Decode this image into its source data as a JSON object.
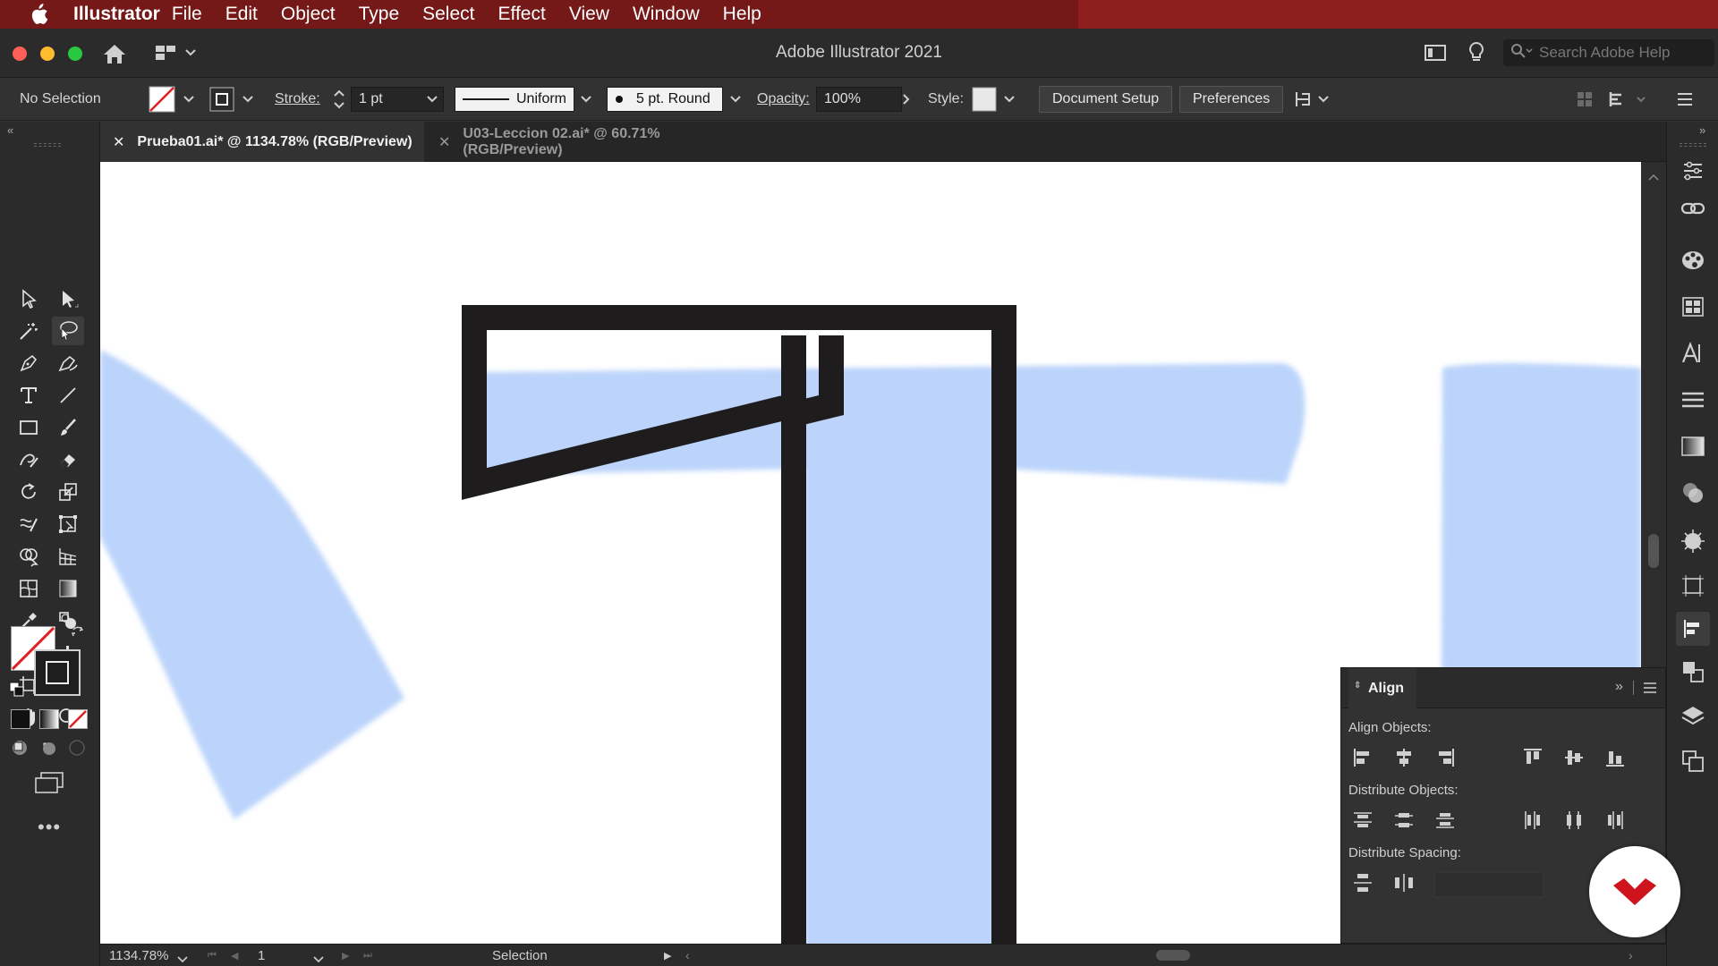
{
  "menubar": {
    "app_name": "Illustrator",
    "items": [
      "File",
      "Edit",
      "Object",
      "Type",
      "Select",
      "Effect",
      "View",
      "Window",
      "Help"
    ]
  },
  "window": {
    "title": "Adobe Illustrator 2021",
    "search_placeholder": "Search Adobe Help"
  },
  "controlbar": {
    "selection_status": "No Selection",
    "stroke_label": "Stroke:",
    "stroke_value": "1 pt",
    "profile_value": "Uniform",
    "brush_value": "5 pt. Round",
    "opacity_label": "Opacity:",
    "opacity_value": "100%",
    "style_label": "Style:",
    "document_setup_label": "Document Setup",
    "preferences_label": "Preferences"
  },
  "tabs": [
    {
      "label": "Prueba01.ai* @ 1134.78% (RGB/Preview)",
      "active": true
    },
    {
      "label": "U03-Leccion 02.ai* @ 60.71% (RGB/Preview)",
      "active": false
    }
  ],
  "statusbar": {
    "zoom": "1134.78%",
    "artboard": "1",
    "tool": "Selection"
  },
  "align_panel": {
    "title": "Align",
    "align_objects_label": "Align Objects:",
    "distribute_objects_label": "Distribute Objects:",
    "distribute_spacing_label": "Distribute Spacing:"
  },
  "colors": {
    "menubar": "#741818",
    "artwork_fill": "#bcd4fb",
    "artwork_stroke": "#1e1c1d",
    "badge": "#d0141e"
  },
  "icons": {
    "tools": [
      "selection-tool",
      "direct-selection-tool",
      "magic-wand-tool",
      "lasso-tool",
      "pen-tool",
      "curvature-tool",
      "type-tool",
      "line-segment-tool",
      "rectangle-tool",
      "paintbrush-tool",
      "shaper-tool",
      "eraser-tool",
      "rotate-tool",
      "scale-tool",
      "warp-tool",
      "free-transform-tool",
      "shape-builder-tool",
      "perspective-grid-tool",
      "mesh-tool",
      "gradient-tool",
      "eyedropper-tool",
      "blend-tool",
      "symbol-sprayer-tool",
      "column-graph-tool",
      "artboard-tool",
      "slice-tool",
      "hand-tool",
      "zoom-tool"
    ]
  }
}
